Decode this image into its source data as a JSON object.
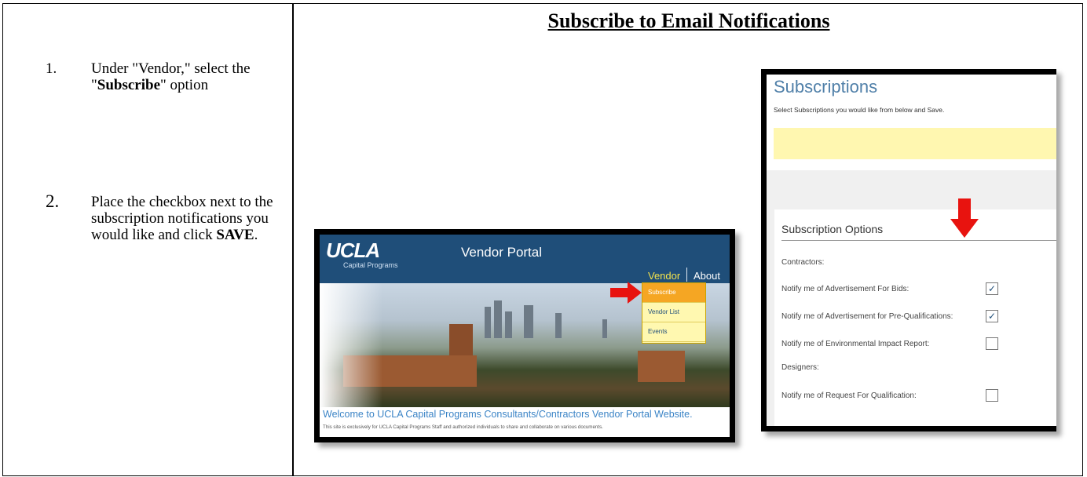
{
  "heading": "Subscribe to Email Notifications",
  "steps": [
    {
      "number": "1.",
      "text_before": "Under \"Vendor,\" select the \"",
      "bold": "Subscribe",
      "text_after": "\" option"
    },
    {
      "number": "2.",
      "text_before": "Place the checkbox next to the subscription notifications you would like and click ",
      "bold": "SAVE",
      "text_after": "."
    }
  ],
  "vendor_portal": {
    "logo": "UCLA",
    "logo_sub": "Capital Programs",
    "title": "Vendor Portal",
    "nav": [
      "Vendor",
      "About"
    ],
    "menu": [
      "Subscribe",
      "Vendor List",
      "Events"
    ],
    "welcome": "Welcome to UCLA Capital Programs Consultants/Contractors Vendor Portal Website.",
    "small_text": "This site is exclusively for UCLA Capital Programs Staff and authorized individuals to share and collaborate on various documents."
  },
  "subscriptions": {
    "title": "Subscriptions",
    "instruction": "Select Subscriptions you would like from below and Save.",
    "card_title": "Subscription Options",
    "contractors_label": "Contractors:",
    "designers_label": "Designers:",
    "options": [
      {
        "label": "Notify me of Advertisement For Bids:",
        "checked": true
      },
      {
        "label": "Notify me of Advertisement for Pre-Qualifications:",
        "checked": true
      },
      {
        "label": "Notify me of Environmental Impact Report:",
        "checked": false
      },
      {
        "label": "Notify me of Request For Qualification:",
        "checked": false
      }
    ]
  },
  "colors": {
    "accent_red": "#e8130f",
    "portal_blue": "#1f4e79",
    "menu_yellow": "#fff8b0",
    "menu_selected": "#f5a623"
  }
}
